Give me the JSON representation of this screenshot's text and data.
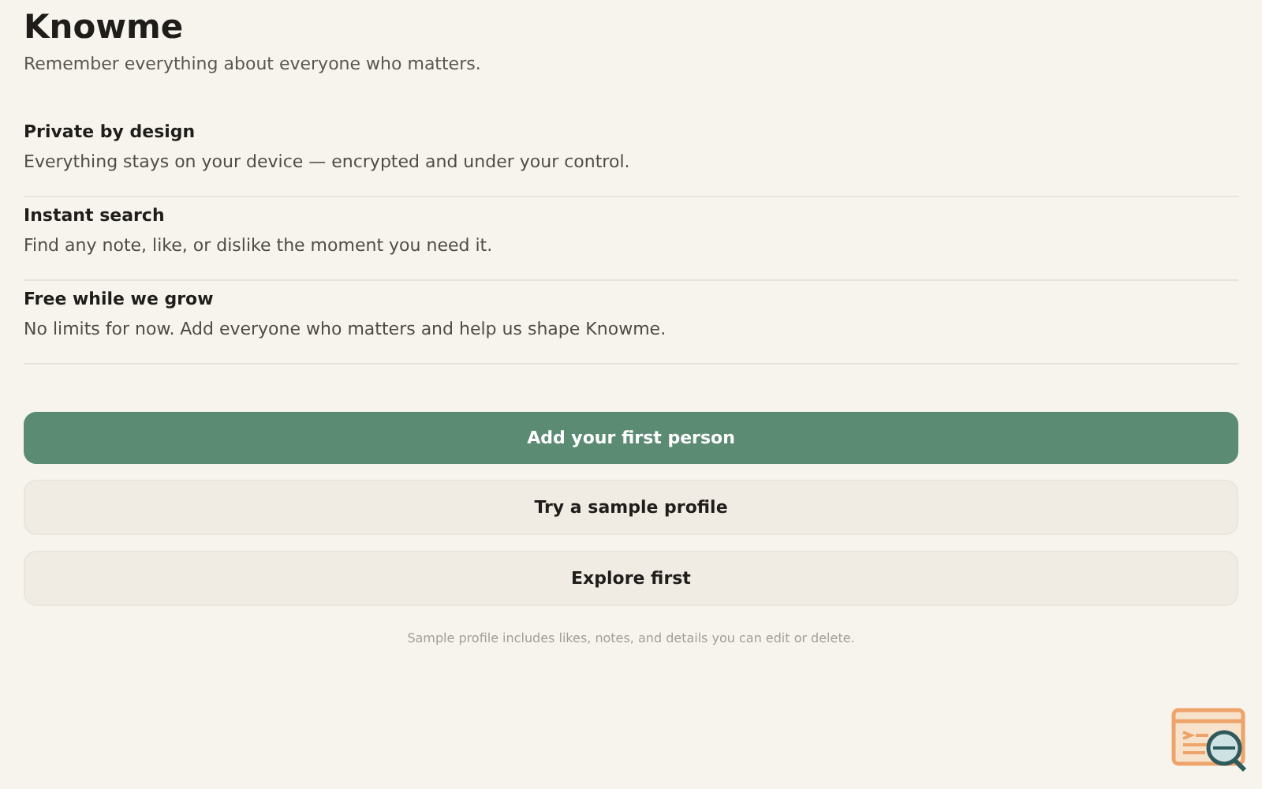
{
  "header": {
    "title": "Knowme",
    "subtitle": "Remember everything about everyone who matters."
  },
  "features": [
    {
      "title": "Private by design",
      "description": "Everything stays on your device — encrypted and under your control."
    },
    {
      "title": "Instant search",
      "description": "Find any note, like, or dislike the moment you need it."
    },
    {
      "title": "Free while we grow",
      "description": "No limits for now. Add everyone who matters and help us shape Knowme."
    }
  ],
  "actions": [
    {
      "label": "Add your first person",
      "kind": "primary"
    },
    {
      "label": "Try a sample profile",
      "kind": "secondary"
    },
    {
      "label": "Explore first",
      "kind": "secondary"
    }
  ],
  "footnote": "Sample profile includes likes, notes, and details you can edit or delete."
}
